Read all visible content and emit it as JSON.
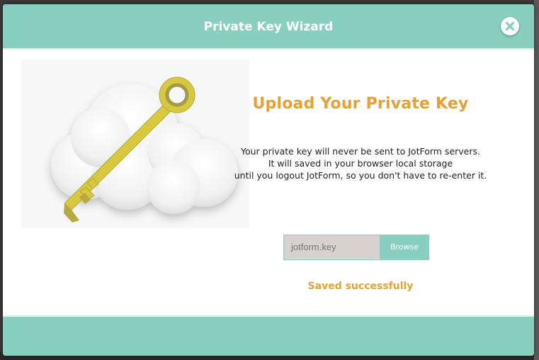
{
  "dialog": {
    "title": "Private Key Wizard",
    "close_icon": "close-icon"
  },
  "main": {
    "heading": "Upload Your Private Key",
    "description_lines": [
      "Your private key will never be sent to JotForm servers.",
      "It will saved in your browser local storage",
      "until you logout JotForm, so you don't have to re-enter it."
    ],
    "file_input": {
      "value": "jotform.key"
    },
    "browse_label": "Browse",
    "status": "Saved successfully"
  },
  "illustration": {
    "icons": [
      "cloud-icon",
      "key-icon"
    ]
  },
  "colors": {
    "header": "#88cfbf",
    "accent": "#e8a032",
    "key": "#d8c83e"
  }
}
